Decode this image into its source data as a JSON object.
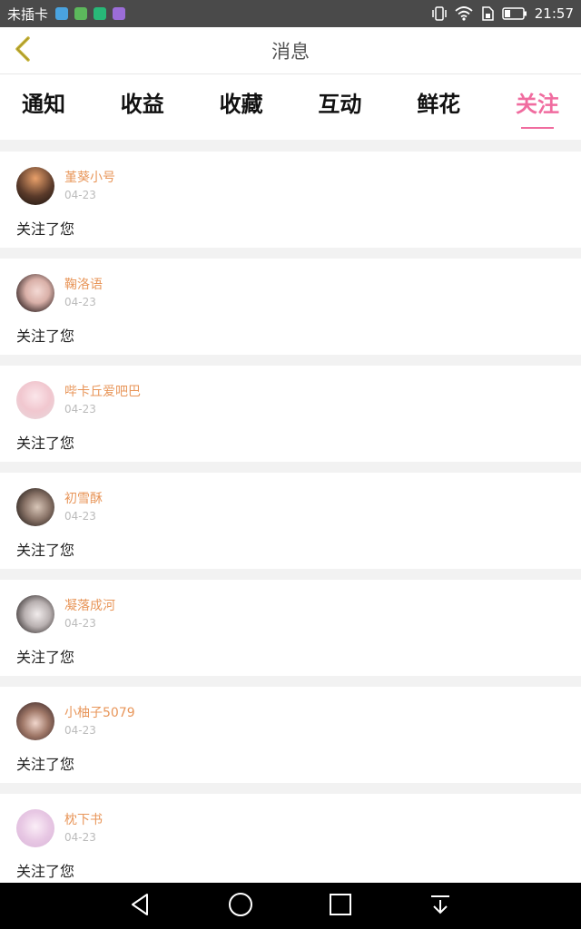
{
  "status_bar": {
    "carrier": "未插卡",
    "time": "21:57",
    "apps": [
      {
        "icon": "image-app-icon",
        "color": "#4aa3df"
      },
      {
        "icon": "browser-app-icon",
        "color": "#5cb85c"
      },
      {
        "icon": "shield-app-icon",
        "color": "#28b878"
      },
      {
        "icon": "photo-app-icon",
        "color": "#9b6dd8"
      }
    ]
  },
  "header": {
    "title": "消息"
  },
  "tabs": [
    {
      "label": "通知"
    },
    {
      "label": "收益"
    },
    {
      "label": "收藏"
    },
    {
      "label": "互动"
    },
    {
      "label": "鲜花"
    },
    {
      "label": "关注"
    }
  ],
  "active_tab": "关注",
  "notifications": [
    {
      "name": "堇葵小号",
      "date": "04-23",
      "message": "关注了您"
    },
    {
      "name": "鞠洛语",
      "date": "04-23",
      "message": "关注了您"
    },
    {
      "name": "哔卡丘爱吧巴",
      "date": "04-23",
      "message": "关注了您"
    },
    {
      "name": "初雪酥",
      "date": "04-23",
      "message": "关注了您"
    },
    {
      "name": "凝落成河",
      "date": "04-23",
      "message": "关注了您"
    },
    {
      "name": "小柚子5079",
      "date": "04-23",
      "message": "关注了您"
    },
    {
      "name": "枕下书",
      "date": "04-23",
      "message": "关注了您"
    }
  ],
  "colors": {
    "accent_pink": "#f06c9f",
    "name_orange": "#e8965a",
    "back_arrow": "#c8b53a"
  }
}
